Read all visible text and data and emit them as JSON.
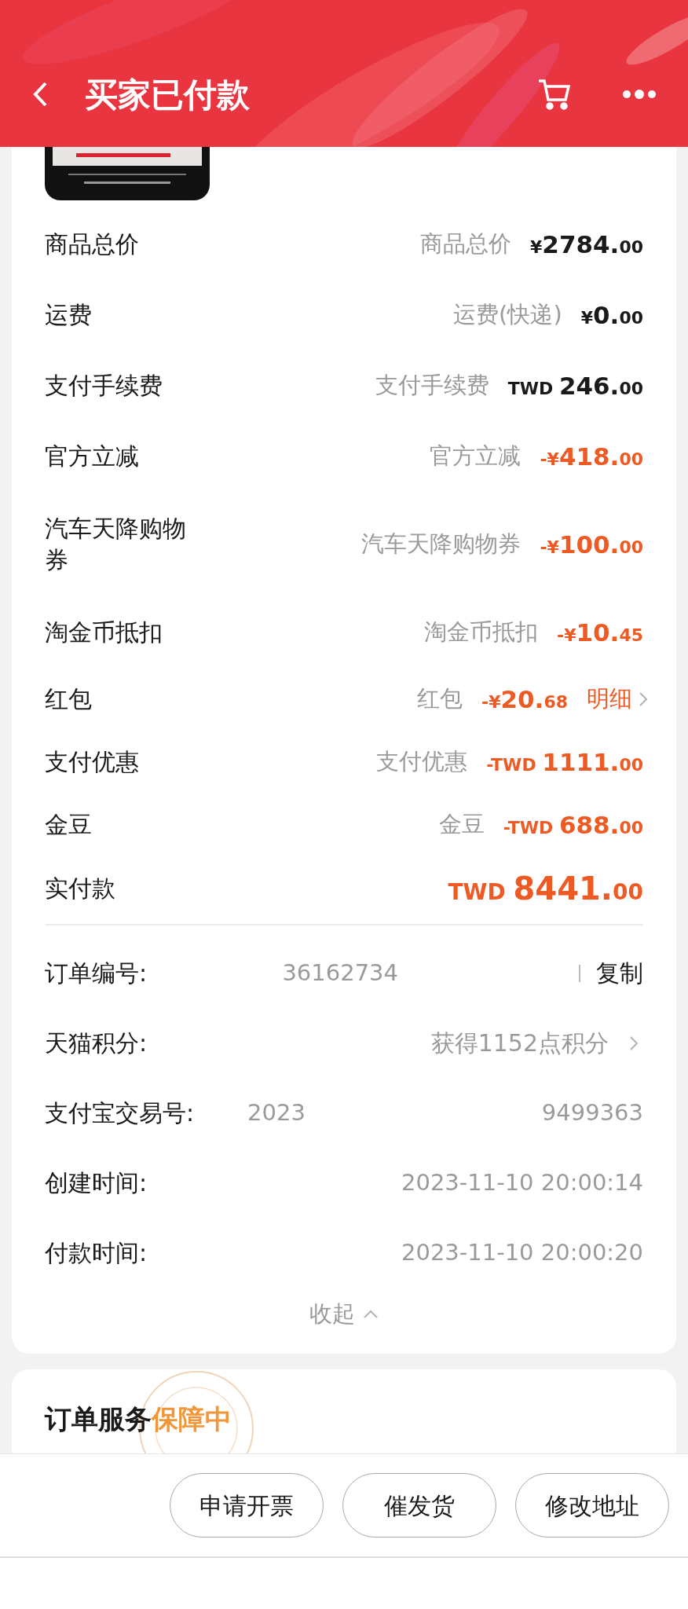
{
  "header": {
    "title": "买家已付款"
  },
  "price_rows": [
    {
      "label": "商品总价",
      "desc": "商品总价",
      "kind": "charge",
      "currency": "¥",
      "integer": "2784.",
      "fraction": "00"
    },
    {
      "label": "运费",
      "desc": "运费(快递)",
      "kind": "charge",
      "currency": "¥",
      "integer": "0.",
      "fraction": "00"
    },
    {
      "label": "支付手续费",
      "desc": "支付手续费",
      "kind": "charge",
      "currency": "TWD ",
      "integer": "246.",
      "fraction": "00"
    },
    {
      "label": "官方立减",
      "desc": "官方立减",
      "kind": "discount",
      "currency": "-¥",
      "integer": "418.",
      "fraction": "00"
    },
    {
      "label": "汽车天降购物券",
      "desc": "汽车天降购物券",
      "kind": "discount",
      "currency": "-¥",
      "integer": "100.",
      "fraction": "00"
    },
    {
      "label": "淘金币抵扣",
      "desc": "淘金币抵扣",
      "kind": "discount",
      "currency": "-¥",
      "integer": "10.",
      "fraction": "45"
    },
    {
      "label": "红包",
      "desc": "红包",
      "kind": "discount",
      "currency": "-¥",
      "integer": "20.",
      "fraction": "68",
      "link": "明细"
    },
    {
      "label": "支付优惠",
      "desc": "支付优惠",
      "kind": "discount",
      "currency": "-TWD ",
      "integer": "1111.",
      "fraction": "00"
    },
    {
      "label": "金豆",
      "desc": "金豆",
      "kind": "discount",
      "currency": "-TWD ",
      "integer": "688.",
      "fraction": "00"
    },
    {
      "label": "实付款",
      "kind": "total",
      "currency": "TWD ",
      "integer": "8441.",
      "fraction": "00"
    }
  ],
  "info_rows": [
    {
      "label": "订单编号:",
      "kind": "copy",
      "values": [
        "36162734"
      ],
      "action": "复制"
    },
    {
      "label": "天猫积分:",
      "kind": "link",
      "values": [
        "获得1152点积分"
      ]
    },
    {
      "label": "支付宝交易号:",
      "kind": "split",
      "values": [
        "2023",
        "9499363"
      ]
    },
    {
      "label": "创建时间:",
      "kind": "plain",
      "values": [
        "2023-11-10 20:00:14"
      ]
    },
    {
      "label": "付款时间:",
      "kind": "plain",
      "values": [
        "2023-11-10 20:00:20"
      ]
    }
  ],
  "collapse": {
    "label": "收起"
  },
  "service": {
    "title": "订单服务",
    "status": "保障中"
  },
  "buttons": [
    "申请开票",
    "催发货",
    "修改地址"
  ]
}
